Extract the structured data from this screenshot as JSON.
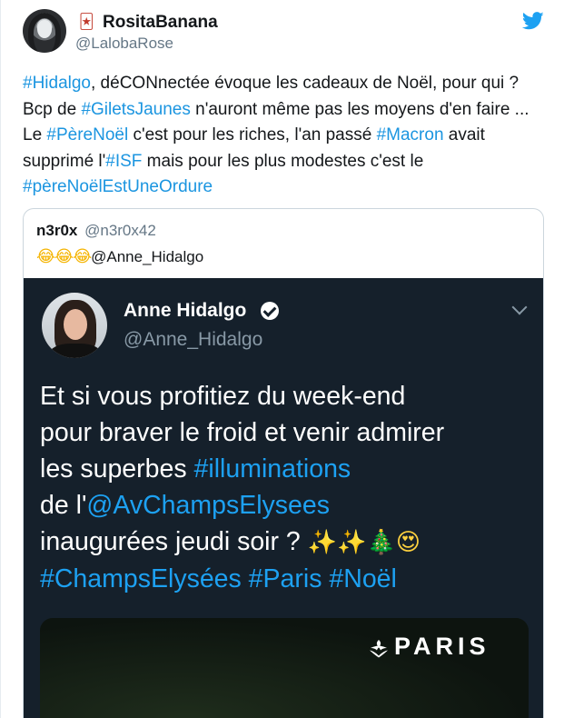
{
  "tweet": {
    "display_name": "RositaBanana",
    "name_emoji": "🃏",
    "handle": "@LalobaRose",
    "text_segments": [
      {
        "t": "#Hidalgo",
        "hl": true
      },
      {
        "t": ", déCONnectée évoque les cadeaux de Noël, pour qui ? Bcp de ",
        "hl": false
      },
      {
        "t": "#GiletsJaunes",
        "hl": true
      },
      {
        "t": " n'auront même pas les moyens d'en faire ... Le ",
        "hl": false
      },
      {
        "t": "#PèreNoël",
        "hl": true
      },
      {
        "t": " c'est pour les riches, l'an passé ",
        "hl": false
      },
      {
        "t": "#Macron",
        "hl": true
      },
      {
        "t": " avait supprimé l'",
        "hl": false
      },
      {
        "t": "#ISF",
        "hl": true
      },
      {
        "t": " mais pour les plus modestes c'est le ",
        "hl": false
      },
      {
        "t": "#pèreNoëlEstUneOrdure",
        "hl": true
      }
    ]
  },
  "quoted": {
    "name": "n3r0x",
    "handle": "@n3r0x42",
    "emojis": "😂😂😂",
    "mention": "@Anne_Hidalgo",
    "screenshot": {
      "name": "Anne Hidalgo",
      "handle": "@Anne_Hidalgo",
      "lines": [
        [
          {
            "t": "Et si vous profitiez du week-end",
            "c": ""
          }
        ],
        [
          {
            "t": "pour braver le froid et venir admirer",
            "c": ""
          }
        ],
        [
          {
            "t": "les superbes ",
            "c": ""
          },
          {
            "t": "#illuminations",
            "c": "hl"
          }
        ],
        [
          {
            "t": "de l'",
            "c": ""
          },
          {
            "t": "@AvChampsElysees",
            "c": "hl"
          }
        ],
        [
          {
            "t": "inaugurées jeudi soir ? ",
            "c": ""
          },
          {
            "t": "✨✨",
            "c": "emo"
          },
          {
            "t": "🎄",
            "c": "emo tree"
          },
          {
            "t": "😍",
            "c": "emo"
          }
        ],
        [
          {
            "t": "#ChampsElysées #Paris #Noël",
            "c": "hl"
          }
        ]
      ],
      "media_logo_text": "PARIS"
    }
  },
  "icons": {
    "brand": "twitter-bird-icon",
    "verified": "verified-badge-icon",
    "chevron": "chevron-down-icon"
  },
  "colors": {
    "link": "#1b95e0",
    "dark_bg": "#15202b",
    "muted": "#657786"
  }
}
